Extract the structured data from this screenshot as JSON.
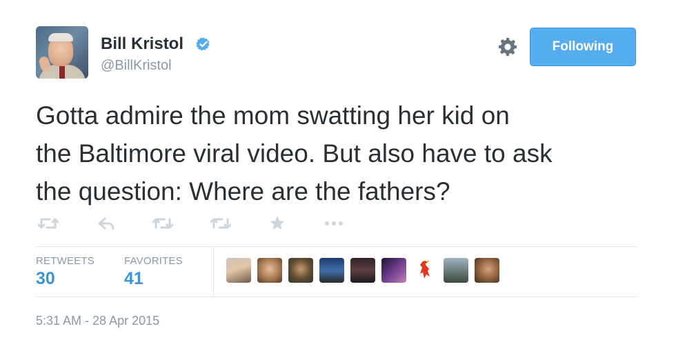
{
  "author": {
    "name": "Bill Kristol",
    "handle": "@BillKristol",
    "verified": true
  },
  "header": {
    "follow_label": "Following",
    "gear_icon": "gear-icon"
  },
  "tweet": {
    "line1": "Gotta admire the mom swatting her kid on",
    "line2": "the Baltimore viral video. But also have to ask",
    "line3": "the question: Where are the fathers?"
  },
  "actions": [
    "retweet-icon",
    "reply-icon",
    "retweet-icon",
    "retweet-icon",
    "favorite-star-icon",
    "more-dots-icon"
  ],
  "stats": {
    "retweets_label": "RETWEETS",
    "retweets_count": "30",
    "favorites_label": "FAVORITES",
    "favorites_count": "41"
  },
  "favorited_by_count_shown": 9,
  "timestamp": "5:31 AM - 28 Apr 2015",
  "colors": {
    "accent": "#55acee",
    "link": "#3b94d9",
    "muted": "#8899a6",
    "text": "#292f33",
    "verified": "#55acee"
  }
}
